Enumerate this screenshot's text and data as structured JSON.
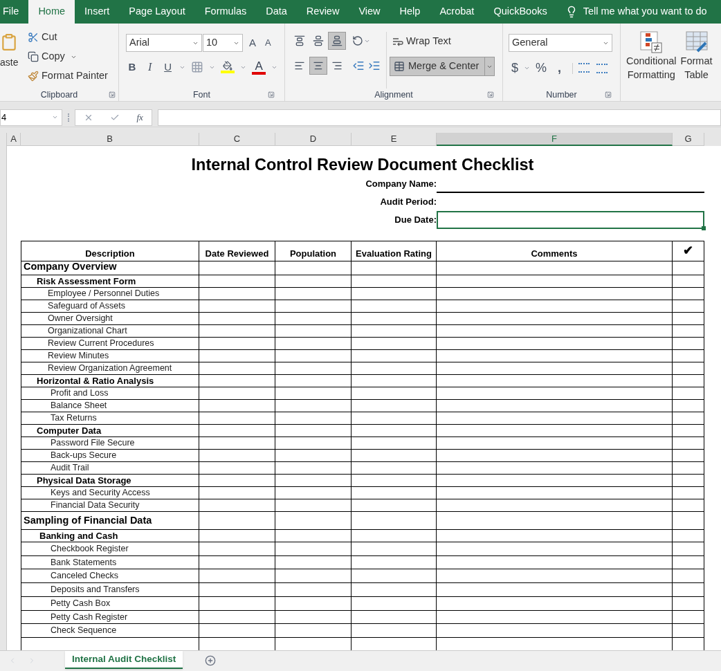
{
  "ribbon_tabs": [
    {
      "label": "File",
      "selected": false
    },
    {
      "label": "Home",
      "selected": true
    },
    {
      "label": "Insert",
      "selected": false
    },
    {
      "label": "Page Layout",
      "selected": false
    },
    {
      "label": "Formulas",
      "selected": false
    },
    {
      "label": "Data",
      "selected": false
    },
    {
      "label": "Review",
      "selected": false
    },
    {
      "label": "View",
      "selected": false
    },
    {
      "label": "Help",
      "selected": false
    },
    {
      "label": "Acrobat",
      "selected": false
    },
    {
      "label": "QuickBooks",
      "selected": false
    }
  ],
  "tell_me": {
    "placeholder": "Tell me what you want to do"
  },
  "clipboard": {
    "paste": "aste",
    "cut": "Cut",
    "copy": "Copy",
    "format_painter": "Format Painter",
    "label": "Clipboard"
  },
  "font": {
    "name": "Arial",
    "size": "10",
    "grow": "A",
    "shrink": "A",
    "bold": "B",
    "italic": "I",
    "underline": "U",
    "color_letter": "A",
    "label": "Font"
  },
  "alignment": {
    "vertical": [
      {
        "kind": "top",
        "selected": false
      },
      {
        "kind": "middle",
        "selected": false
      },
      {
        "kind": "bottom",
        "selected": true
      }
    ],
    "horizontal": [
      {
        "kind": "left",
        "selected": false
      },
      {
        "kind": "center",
        "selected": true
      },
      {
        "kind": "right",
        "selected": false
      }
    ],
    "wrap_text": {
      "label": "Wrap Text",
      "selected": false
    },
    "merge_center": {
      "label": "Merge & Center",
      "selected": true
    },
    "label": "Alignment"
  },
  "number": {
    "format": "General",
    "currency": "$",
    "percent": "%",
    "comma": ",",
    "label": "Number"
  },
  "styles": {
    "conditional": [
      "Conditional",
      "Formatting"
    ],
    "format_table": [
      "Format",
      "Table"
    ]
  },
  "name_box": "4",
  "insert_function": "fx",
  "columns": [
    {
      "label": "A",
      "selected": false
    },
    {
      "label": "B",
      "selected": false
    },
    {
      "label": "C",
      "selected": false
    },
    {
      "label": "D",
      "selected": false
    },
    {
      "label": "E",
      "selected": false
    },
    {
      "label": "F",
      "selected": true
    },
    {
      "label": "G",
      "selected": false
    }
  ],
  "sheet": {
    "title": "Internal Control Review Document Checklist",
    "fields": [
      {
        "label": "Company Name:",
        "kind": "line",
        "selected": false
      },
      {
        "label": "Audit Period:",
        "kind": "blank",
        "selected": false
      },
      {
        "label": "Due Date:",
        "kind": "blank",
        "selected": true
      }
    ],
    "table_headers": [
      "Description",
      "Date Reviewed",
      "Population",
      "Evaluation Rating",
      "Comments",
      "✔"
    ],
    "sections": [
      {
        "title": "Company Overview",
        "groups": [
          {
            "title": "Risk Assessment Form",
            "items": [
              "Employee / Personnel Duties",
              "Safeguard of Assets",
              "Owner Oversight",
              "Organizational Chart",
              "Review Current Procedures",
              "Review Minutes",
              "Review Organization Agreement"
            ]
          },
          {
            "title": "Horizontal & Ratio Analysis",
            "items": [
              "Profit and Loss",
              "Balance Sheet",
              "Tax Returns"
            ]
          },
          {
            "title": "Computer Data",
            "items": [
              "Password File Secure",
              "Back-ups Secure",
              "Audit Trail"
            ]
          },
          {
            "title": "Physical Data Storage",
            "items": [
              "Keys and Security Access",
              "Financial Data Security"
            ]
          }
        ]
      },
      {
        "title": "Sampling of Financial Data",
        "groups": [
          {
            "title": "Banking and Cash",
            "items": [
              "Checkbook Register",
              "Bank Statements",
              "Canceled Checks",
              "Deposits and Transfers",
              "Petty Cash Box",
              "Petty Cash Register",
              "Check Sequence"
            ]
          }
        ]
      }
    ]
  },
  "sheet_tabs": [
    {
      "label": "Internal Audit Checklist",
      "selected": true
    }
  ]
}
